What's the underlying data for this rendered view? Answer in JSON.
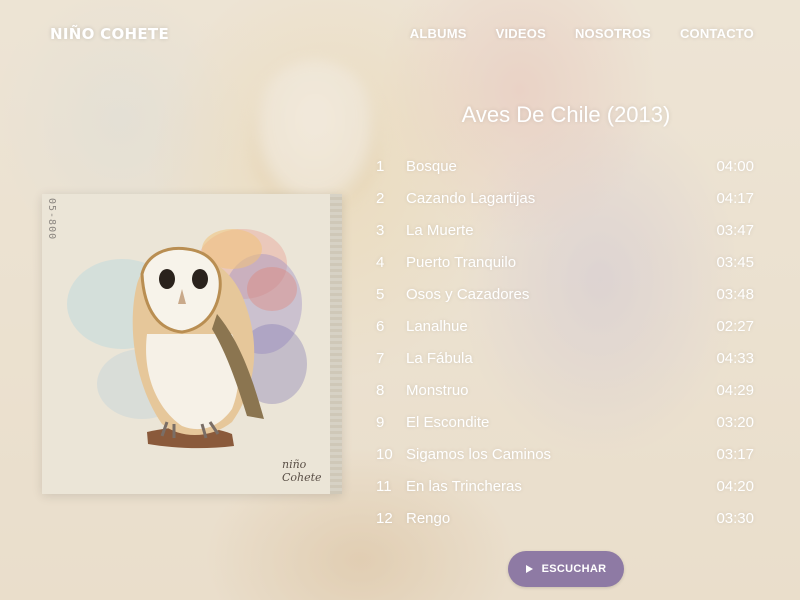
{
  "brand": "NIÑO COHETE",
  "nav": [
    "ALBUMS",
    "VIDEOS",
    "NOSOTROS",
    "CONTACTO"
  ],
  "album": {
    "title": "Aves De Chile (2013)",
    "cover_stamp": "05-800",
    "cover_signature": "niño Cohete"
  },
  "tracks": [
    {
      "num": "1",
      "name": "Bosque",
      "duration": "04:00"
    },
    {
      "num": "2",
      "name": "Cazando Lagartijas",
      "duration": "04:17"
    },
    {
      "num": "3",
      "name": "La Muerte",
      "duration": "03:47"
    },
    {
      "num": "4",
      "name": "Puerto Tranquilo",
      "duration": "03:45"
    },
    {
      "num": "5",
      "name": "Osos y Cazadores",
      "duration": "03:48"
    },
    {
      "num": "6",
      "name": "Lanalhue",
      "duration": "02:27"
    },
    {
      "num": "7",
      "name": "La Fábula",
      "duration": "04:33"
    },
    {
      "num": "8",
      "name": "Monstruo",
      "duration": "04:29"
    },
    {
      "num": "9",
      "name": "El Escondite",
      "duration": "03:20"
    },
    {
      "num": "10",
      "name": "Sigamos los Caminos",
      "duration": "03:17"
    },
    {
      "num": "11",
      "name": "En las Trincheras",
      "duration": "04:20"
    },
    {
      "num": "12",
      "name": "Rengo",
      "duration": "03:30"
    }
  ],
  "play_button": {
    "label": "ESCUCHAR",
    "icon": "play-icon",
    "color": "#8e7aa4"
  }
}
